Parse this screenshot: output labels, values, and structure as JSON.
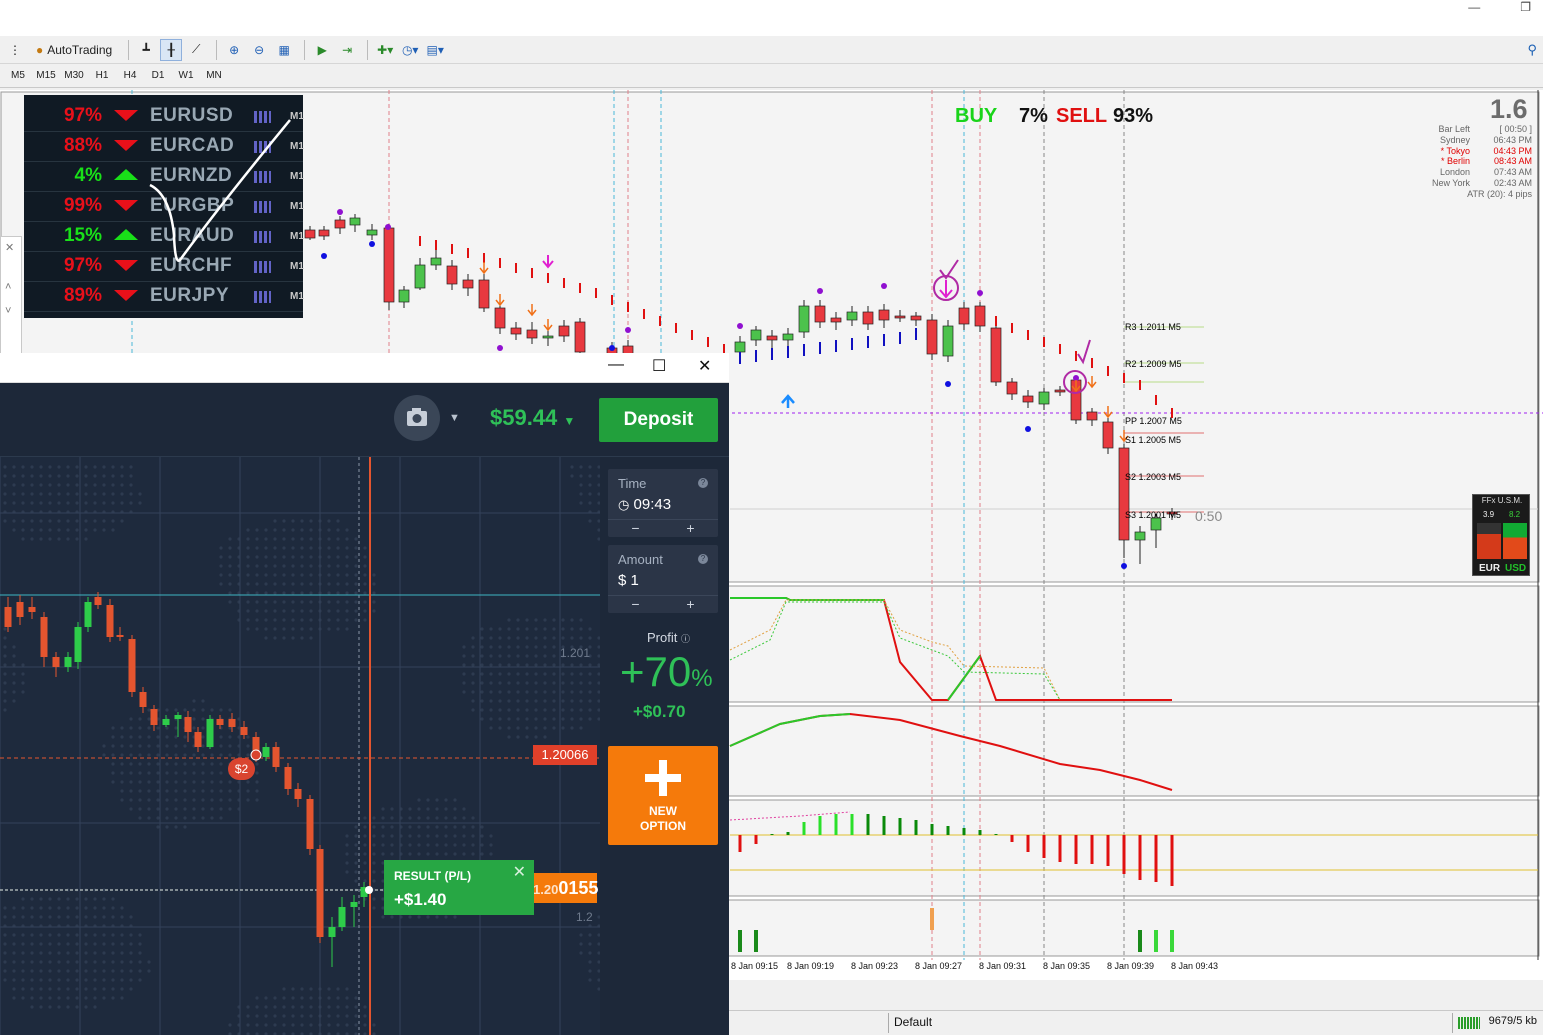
{
  "toolbar": {
    "autotrading_label": "AutoTrading",
    "timeframes": [
      "M5",
      "M15",
      "M30",
      "H1",
      "H4",
      "D1",
      "W1",
      "MN"
    ]
  },
  "strength_panel": {
    "rows": [
      {
        "pct": "97%",
        "symbol": "EURUSD",
        "tf": "M1",
        "dir": "down"
      },
      {
        "pct": "88%",
        "symbol": "EURCAD",
        "tf": "M1",
        "dir": "down"
      },
      {
        "pct": "4%",
        "symbol": "EURNZD",
        "tf": "M1",
        "dir": "up"
      },
      {
        "pct": "99%",
        "symbol": "EURGBP",
        "tf": "M1",
        "dir": "down"
      },
      {
        "pct": "15%",
        "symbol": "EURAUD",
        "tf": "M1",
        "dir": "up"
      },
      {
        "pct": "97%",
        "symbol": "EURCHF",
        "tf": "M1",
        "dir": "down"
      },
      {
        "pct": "89%",
        "symbol": "EURJPY",
        "tf": "M1",
        "dir": "down"
      }
    ],
    "up_color": "#19e019",
    "down_color": "#e8101a"
  },
  "signal": {
    "buy_label": "BUY",
    "buy_pct": "7%",
    "sell_label": "SELL",
    "sell_pct": "93%"
  },
  "clock": {
    "big": "1.6",
    "rows": [
      {
        "label": "Bar Left",
        "value": "[ 00:50 ]",
        "red": false
      },
      {
        "label": "Sydney",
        "value": "06:43 PM",
        "red": false
      },
      {
        "label": "* Tokyo",
        "value": "04:43 PM",
        "red": true
      },
      {
        "label": "* Berlin",
        "value": "08:43 AM",
        "red": true
      },
      {
        "label": "London",
        "value": "07:43 AM",
        "red": false
      },
      {
        "label": "New York",
        "value": "02:43 AM",
        "red": false
      }
    ],
    "atr": "ATR (20): 4 pips",
    "bar_timer": "0:50"
  },
  "pivots": [
    {
      "label": "R3 1.2011 M5",
      "color": "#a8d96a"
    },
    {
      "label": "R2 1.2009 M5",
      "color": "#a8d96a"
    },
    {
      "label": "PP 1.2007 M5",
      "color": "#e05050"
    },
    {
      "label": "S1 1.2005 M5",
      "color": "#e07070"
    },
    {
      "label": "S2 1.2003 M5",
      "color": "#e07070"
    },
    {
      "label": "S3 1.2001 M5",
      "color": "#e07070"
    }
  ],
  "ffx": {
    "title": "FFx U.S.M.",
    "val1": "3.9",
    "val2": "8.2",
    "cur1": "EUR",
    "cur2": "USD"
  },
  "x_axis": [
    "8 Jan 09:15",
    "8 Jan 09:19",
    "8 Jan 09:23",
    "8 Jan 09:27",
    "8 Jan 09:31",
    "8 Jan 09:35",
    "8 Jan 09:39",
    "8 Jan 09:43"
  ],
  "status": {
    "profile": "Default",
    "traffic": "9679/5 kb"
  },
  "iq": {
    "balance": "$59.44",
    "deposit_label": "Deposit",
    "time_label": "Time",
    "time_value": "09:43",
    "amount_label": "Amount",
    "amount_value": "$ 1",
    "minus": "−",
    "plus": "+",
    "profit_label": "Profit",
    "profit_pct": "+70",
    "profit_pct_sign": "%",
    "profit_amount": "+$0.70",
    "new_option_label_1": "NEW",
    "new_option_label_2": "OPTION",
    "result_title": "RESULT (P/L)",
    "result_value": "+$1.40",
    "current_price_dim": "1.20",
    "current_price_main": "0155",
    "entry_price": "1.20066",
    "badge": "$2",
    "y_labels": [
      "1.201",
      "1.2"
    ]
  }
}
